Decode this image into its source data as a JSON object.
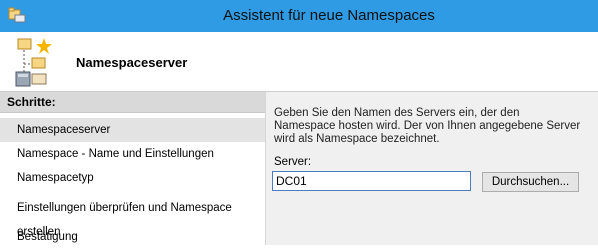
{
  "window": {
    "title": "Assistent für neue Namespaces",
    "icon": "namespace-wizard-icon"
  },
  "header": {
    "title": "Namespaceserver",
    "icon": "namespace-tree-icon"
  },
  "steps": {
    "heading": "Schritte:",
    "items": [
      {
        "label": "Namespaceserver",
        "active": true
      },
      {
        "label": "Namespace - Name und Einstellungen",
        "active": false
      },
      {
        "label": "Namespacetyp",
        "active": false
      },
      {
        "label": "Einstellungen überprüfen und Namespace erstellen",
        "active": false
      },
      {
        "label": "Bestätigung",
        "active": false
      }
    ]
  },
  "content": {
    "description": "Geben Sie den Namen des Servers ein, der den Namespace hosten wird. Der von Ihnen angegebene Server wird als Namespace bezeichnet.",
    "server_label": "Server:",
    "server_value": "DC01",
    "browse_label": "Durchsuchen..."
  },
  "colors": {
    "titlebar": "#2f9be4",
    "active_step": "#e3e3e3"
  }
}
